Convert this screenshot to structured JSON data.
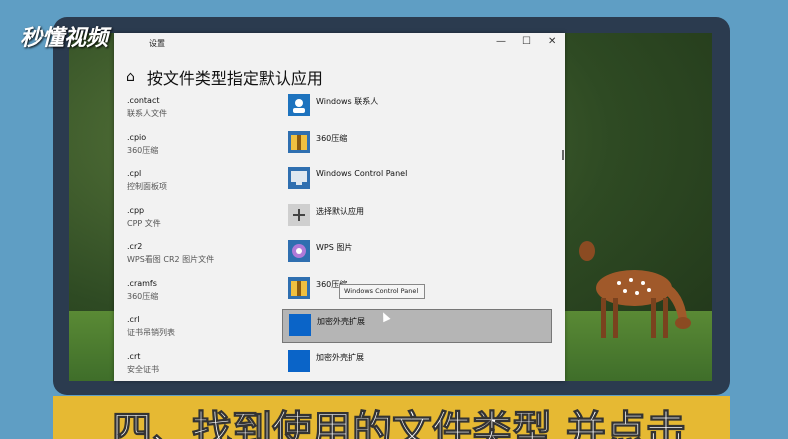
{
  "logo_text": "秒懂视频",
  "window": {
    "title": "设置",
    "controls": {
      "minimize": "—",
      "maximize": "☐",
      "close": "✕"
    },
    "header": "按文件类型指定默认应用",
    "home_icon": "home-icon"
  },
  "rows": [
    {
      "ext": ".contact",
      "desc": "联系人文件",
      "app": "Windows 联系人",
      "icon": "contacts-icon"
    },
    {
      "ext": ".cpio",
      "desc": "360压缩",
      "app": "360压缩",
      "icon": "archive-icon"
    },
    {
      "ext": ".cpl",
      "desc": "控制面板项",
      "app": "Windows Control Panel",
      "icon": "control-panel-icon"
    },
    {
      "ext": ".cpp",
      "desc": "CPP 文件",
      "app": "选择默认应用",
      "icon": "plus-icon"
    },
    {
      "ext": ".cr2",
      "desc": "WPS看图 CR2 图片文件",
      "app": "WPS 图片",
      "icon": "wps-image-icon"
    },
    {
      "ext": ".cramfs",
      "desc": "360压缩",
      "app": "360压缩",
      "icon": "archive-icon"
    },
    {
      "ext": ".crl",
      "desc": "证书吊销列表",
      "app": "加密外壳扩展",
      "icon": "crypto-shell-icon",
      "selected": true
    },
    {
      "ext": ".crt",
      "desc": "安全证书",
      "app": "加密外壳扩展",
      "icon": "crypto-shell-icon"
    }
  ],
  "tooltip": "Windows Control Panel",
  "caption": "四、找到使用的文件类型 并点击",
  "colors": {
    "caption_bar": "#e6b933",
    "accent_blue": "#0a64c8",
    "monitor_frame": "#2b3b4f"
  }
}
